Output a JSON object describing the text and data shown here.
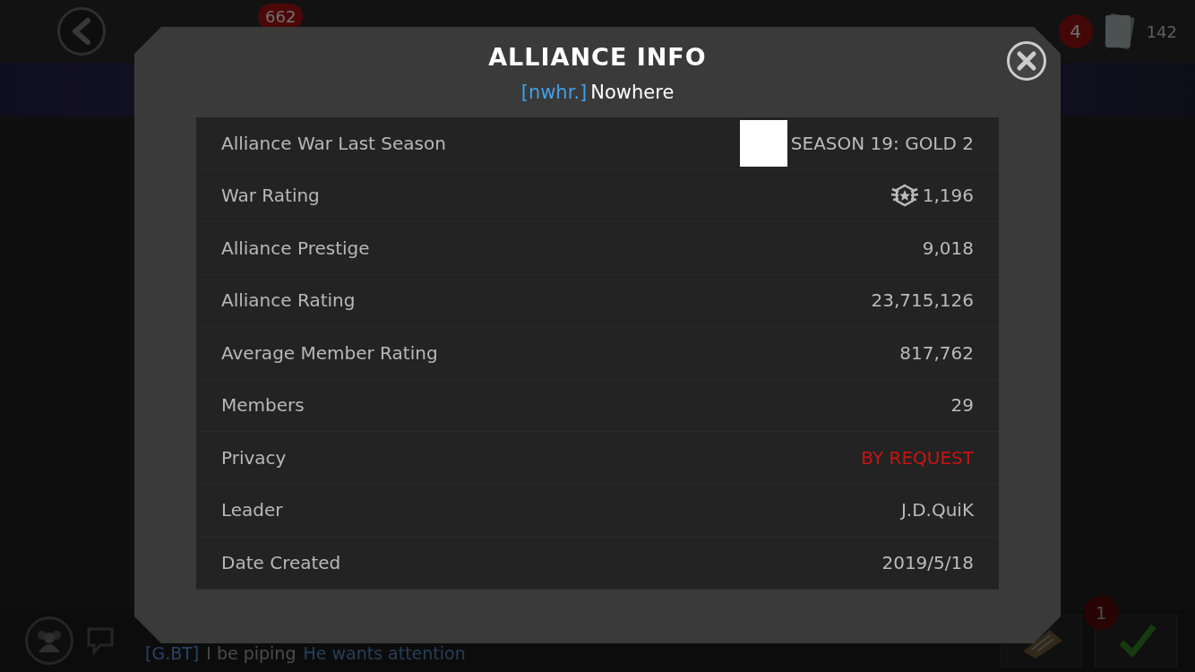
{
  "top_bar": {
    "notification_count": "662",
    "alert_count": "4",
    "currency_amount": "142"
  },
  "dialog": {
    "title": "ALLIANCE INFO",
    "alliance_tag": "[nwhr.]",
    "alliance_name": "Nowhere",
    "rows": [
      {
        "kind": "season",
        "label": "Alliance War Last Season",
        "value": "SEASON 19: GOLD 2"
      },
      {
        "kind": "rating",
        "label": "War Rating",
        "value": "1,196"
      },
      {
        "kind": "text",
        "label": "Alliance Prestige",
        "value": "9,018"
      },
      {
        "kind": "text",
        "label": "Alliance Rating",
        "value": "23,715,126"
      },
      {
        "kind": "text",
        "label": "Average Member Rating",
        "value": "817,762"
      },
      {
        "kind": "text",
        "label": "Members",
        "value": "29"
      },
      {
        "kind": "alert",
        "label": "Privacy",
        "value": "BY REQUEST"
      },
      {
        "kind": "text",
        "label": "Leader",
        "value": "J.D.QuiK"
      },
      {
        "kind": "text",
        "label": "Date Created",
        "value": "2019/5/18"
      }
    ]
  },
  "chat": {
    "tag": "[G.BT]",
    "sender": "I be piping",
    "message": "He wants attention"
  },
  "quest_badge": "1"
}
